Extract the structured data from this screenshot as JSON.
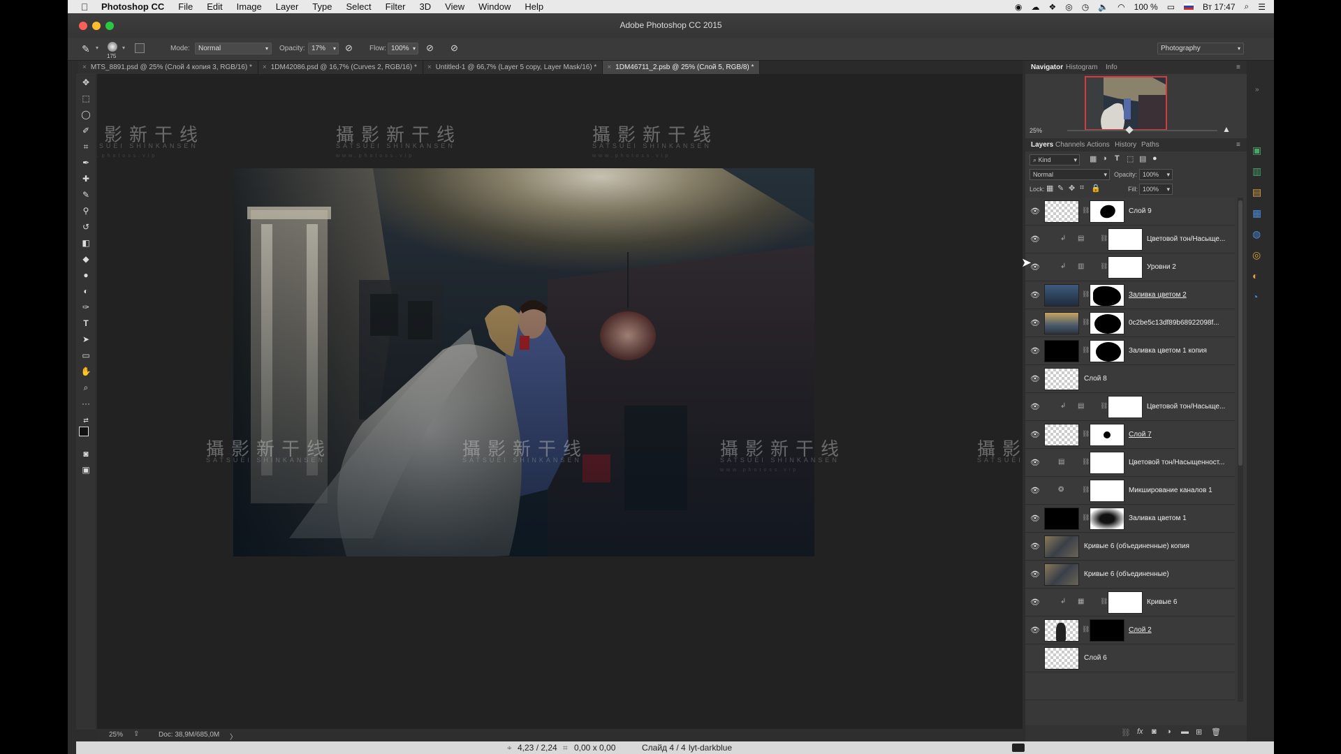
{
  "menubar": {
    "app_name": "Photoshop CC",
    "items": [
      "File",
      "Edit",
      "Image",
      "Layer",
      "Type",
      "Select",
      "Filter",
      "3D",
      "View",
      "Window",
      "Help"
    ],
    "battery": "100 %",
    "clock": "Вт 17:47"
  },
  "window": {
    "title": "Adobe Photoshop CC 2015"
  },
  "options": {
    "brush_size": "175",
    "mode_label": "Mode:",
    "mode_value": "Normal",
    "opacity_label": "Opacity:",
    "opacity_value": "17%",
    "flow_label": "Flow:",
    "flow_value": "100%",
    "workspace": "Photography"
  },
  "tabs": [
    {
      "label": "MTS_8891.psd @ 25% (Слой 4 копия 3, RGB/16) *"
    },
    {
      "label": "1DM42086.psd @ 16,7% (Curves 2, RGB/16) *"
    },
    {
      "label": "Untitled-1 @ 66,7% (Layer 5 copy, Layer Mask/16) *"
    },
    {
      "label": "1DM46711_2.psb @ 25% (Слой 5, RGB/8) *"
    }
  ],
  "watermark": {
    "main": "攝影新干线",
    "sub": "SATSUEI SHINKANSEN",
    "url": "www.photoss.vip"
  },
  "statusbar": {
    "zoom": "25%",
    "doc": "Doc: 38,9M/685,0M",
    "arrow": "〉"
  },
  "bottom_strip": {
    "coords": "4,23 / 2,24",
    "size": "0,00 x 0,00",
    "slide": "Слайд 4 / 4",
    "theme": "lyt-darkblue"
  },
  "navigator": {
    "tabs": [
      "Navigator",
      "Histogram",
      "Info"
    ],
    "zoom": "25%"
  },
  "layers_panel": {
    "tabs": [
      "Layers",
      "Channels",
      "Actions",
      "History",
      "Paths"
    ],
    "kind": "Kind",
    "blend_mode": "Normal",
    "opacity_label": "Opacity:",
    "opacity_value": "100%",
    "lock_label": "Lock:",
    "fill_label": "Fill:",
    "fill_value": "100%",
    "layers": [
      {
        "name": "Слой 9",
        "type": "pixel-mask"
      },
      {
        "name": "Цветовой тон/Насыще...",
        "type": "adj-huesat"
      },
      {
        "name": "Уровни 2",
        "type": "adj-levels"
      },
      {
        "name": "Заливка цветом 2",
        "type": "fill-blue"
      },
      {
        "name": "0c2be5c13df89b68922098f...",
        "type": "photo-mask"
      },
      {
        "name": "Заливка цветом 1 копия",
        "type": "fill-black"
      },
      {
        "name": "Слой 8",
        "type": "pixel"
      },
      {
        "name": "Цветовой тон/Насыще...",
        "type": "adj-huesat"
      },
      {
        "name": "Слой 7",
        "type": "pixel-mask"
      },
      {
        "name": "Цветовой тон/Насыщенност...",
        "type": "adj-huesat2"
      },
      {
        "name": "Микширование каналов 1",
        "type": "adj-mixer"
      },
      {
        "name": "Заливка цветом 1",
        "type": "fill-black2"
      },
      {
        "name": "Кривые 6 (объединенные) копия",
        "type": "photo"
      },
      {
        "name": "Кривые 6 (объединенные)",
        "type": "photo"
      },
      {
        "name": "Кривые 6",
        "type": "adj-curves"
      },
      {
        "name": "Слой 2",
        "type": "pixel-mask2"
      },
      {
        "name": "Слой 6",
        "type": "pixel-hidden"
      }
    ]
  },
  "colors": {
    "accent": "#d63a3a",
    "panel_bg": "#383838",
    "canvas_bg": "#222222"
  }
}
